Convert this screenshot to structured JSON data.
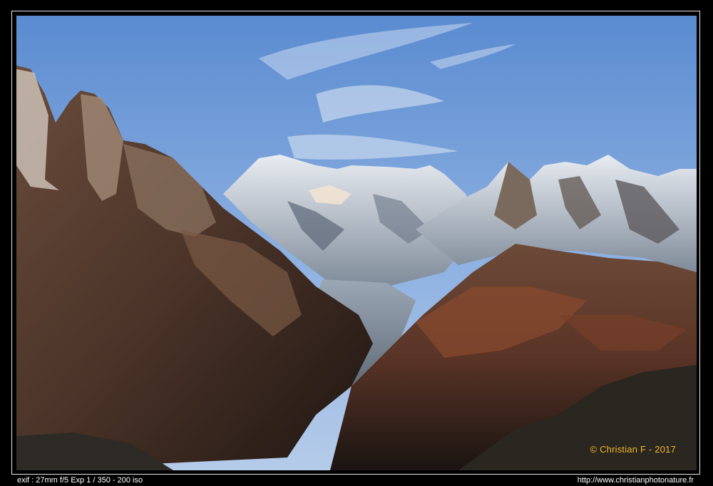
{
  "photo": {
    "copyright": "© Christian F - 2017",
    "alt": "",
    "exif": "exif : 27mm f/5 Exp 1 / 350 - 200 iso",
    "url": "http://www.christianphotonature.fr"
  },
  "colors": {
    "frame_border": "#e6e6e6",
    "copyright_text": "#f1b92a",
    "caption_text": "#ffffff",
    "background": "#000000",
    "sky_top": "#5f8fd2",
    "sky_bottom": "#a9c3e8"
  }
}
